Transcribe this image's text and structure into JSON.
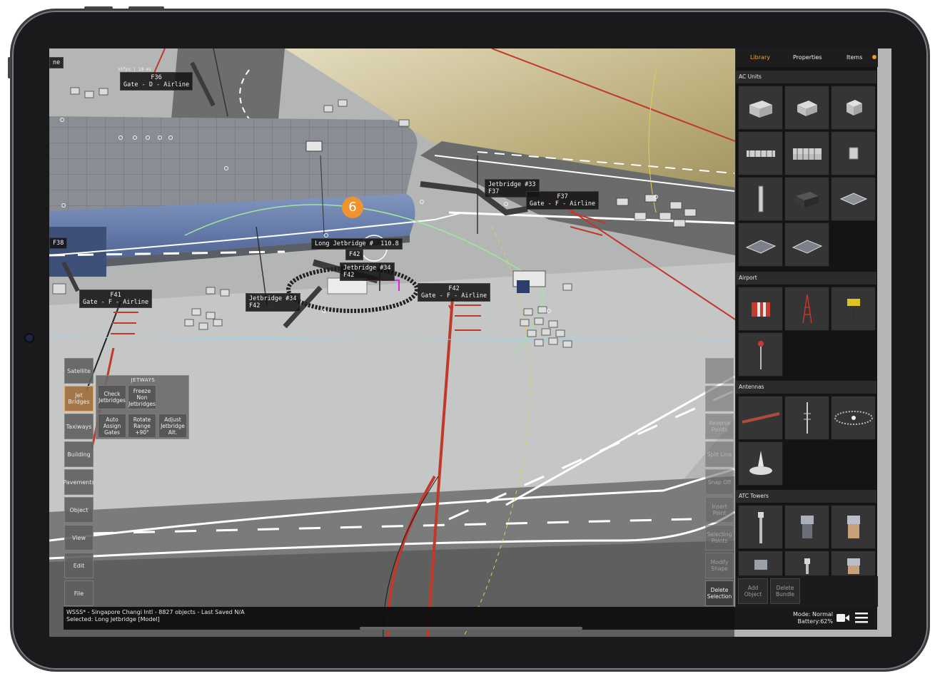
{
  "scene": {
    "fps_text": "55fps | 18 ms",
    "badge": "6",
    "labels": [
      {
        "id": "f36",
        "text": "F36\nGate - D - Airline"
      },
      {
        "id": "jb33",
        "text": "Jetbridge #33\nF37"
      },
      {
        "id": "f37",
        "text": "F37\nGate - F - Airline"
      },
      {
        "id": "f38",
        "text": "F38"
      },
      {
        "id": "long-jb",
        "text": "Long Jetbridge #  110.8"
      },
      {
        "id": "jb-f42-a",
        "text": "F42"
      },
      {
        "id": "jb-sel",
        "text": "Jetbridge #34\nF42"
      },
      {
        "id": "f41",
        "text": "F41\nGate - F - Airline"
      },
      {
        "id": "jb34",
        "text": "Jetbridge #34\nF42"
      },
      {
        "id": "f42",
        "text": "F42\nGate - F - Airline"
      },
      {
        "id": "edge",
        "text": "ne"
      }
    ]
  },
  "left_toolbar": {
    "buttons": [
      "Satellite",
      "Jet Bridges",
      "Taxiways",
      "Building",
      "Pavements",
      "Object",
      "View",
      "Edit",
      "File"
    ],
    "active": "Jet Bridges"
  },
  "jetways": {
    "title": "JETWAYS",
    "buttons": [
      "Check Jetbridges",
      "Freeze Non Jetbridges",
      "Auto Assign Gates",
      "Rotate Range +90°",
      "Adjust Jetbridge Alt."
    ]
  },
  "right_toolbar": {
    "buttons": [
      "",
      "",
      "Reverse Points",
      "Split Line",
      "Snap Off",
      "Insert Point",
      "Selecting Points",
      "Modify Shape",
      "Delete Selection"
    ]
  },
  "library": {
    "tabs": [
      "Library",
      "Properties",
      "Items"
    ],
    "active_tab": "Library",
    "categories": [
      {
        "name": "AC Units",
        "count": 11
      },
      {
        "name": "Airport",
        "count": 4
      },
      {
        "name": "Antennas",
        "count": 4
      },
      {
        "name": "ATC Towers",
        "count": 6
      }
    ],
    "footer": [
      "Add Object",
      "Delete Bundle"
    ]
  },
  "status": {
    "line1": "WSSS* - Singapore Changi Intl - 8827 objects - Last Saved N/A",
    "line2": "Selected: Long Jetbridge [Model]",
    "mode": "Mode: Normal",
    "battery": "Battery:62%"
  },
  "colors": {
    "accent": "#f0922e",
    "taxi_centerline": "#c0392b",
    "library_bg": "#141414"
  },
  "icons": [
    "camera-icon",
    "menu-icon"
  ]
}
